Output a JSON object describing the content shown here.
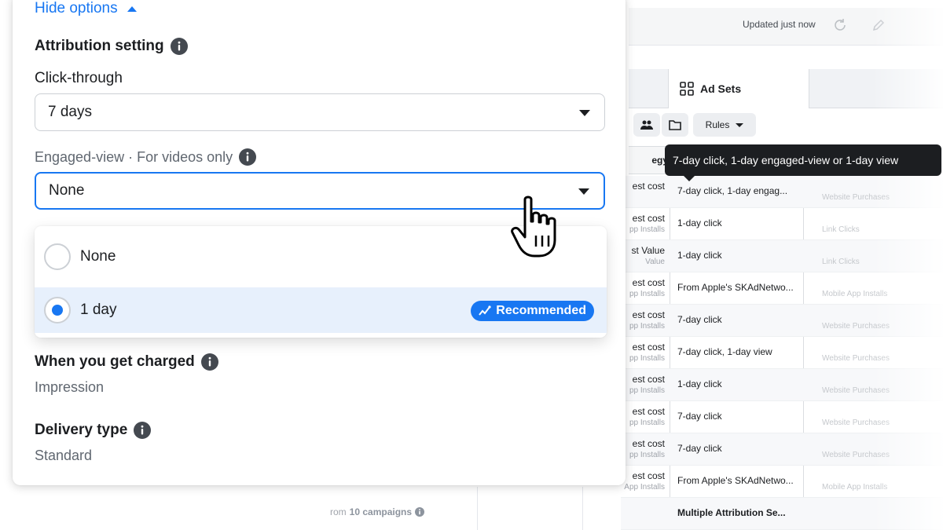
{
  "background": {
    "updated_text": "Updated just now",
    "tab_label": "Ad Sets",
    "rules_label": "Rules",
    "strategy_header": "egy",
    "rows": [
      {
        "s1": "est cost",
        "s2": "",
        "attr": "7-day click, 1-day engag...",
        "result": "Website Purchases"
      },
      {
        "s1": "est cost",
        "s2": "pp Installs",
        "attr": "1-day click",
        "result": "Link Clicks"
      },
      {
        "s1": "st Value",
        "s2": "Value",
        "attr": "1-day click",
        "result": "Link Clicks"
      },
      {
        "s1": "est cost",
        "s2": "pp Installs",
        "attr": "From Apple's SKAdNetwo...",
        "result": "Mobile App Installs"
      },
      {
        "s1": "est cost",
        "s2": "pp Installs",
        "attr": "7-day click",
        "result": "Website Purchases"
      },
      {
        "s1": "est cost",
        "s2": "pp Installs",
        "attr": "7-day click, 1-day view",
        "result": "Website Purchases"
      },
      {
        "s1": "est cost",
        "s2": "pp Installs",
        "attr": "1-day click",
        "result": "Website Purchases"
      },
      {
        "s1": "est cost",
        "s2": "pp Installs",
        "attr": "7-day click",
        "result": "Website Purchases"
      },
      {
        "s1": "est cost",
        "s2": "pp Installs",
        "attr": "7-day click",
        "result": "Website Purchases"
      },
      {
        "s1": "est cost",
        "s2": "App Installs",
        "attr": "From Apple's SKAdNetwo...",
        "result": "Mobile App Installs"
      },
      {
        "s1": "",
        "s2": "",
        "attr": "Multiple Attribution Se...",
        "result": ""
      }
    ],
    "bottom_prefix": "rom",
    "bottom_campaigns": "10 campaigns"
  },
  "tooltip": {
    "text": "7-day click, 1-day engaged-view or 1-day view"
  },
  "panel": {
    "hide_options": "Hide options",
    "attribution_title": "Attribution setting",
    "click_through_label": "Click-through",
    "click_through_value": "7 days",
    "engaged_view_label": "Engaged-view · For videos only",
    "engaged_view_value": "None",
    "options": [
      {
        "label": "None",
        "selected": false
      },
      {
        "label": "1 day",
        "selected": true
      }
    ],
    "recommended_badge": "Recommended",
    "charged_title": "When you get charged",
    "charged_value": "Impression",
    "delivery_title": "Delivery type",
    "delivery_value": "Standard"
  },
  "colors": {
    "accent": "#1877f2",
    "tooltip_bg": "#1c1e21",
    "selected_row_bg": "#e7f0fc"
  },
  "icons": [
    "chevron-up-icon",
    "info-icon",
    "chevron-down-icon",
    "sparkline-icon",
    "hand-cursor-icon",
    "refresh-icon",
    "pencil-icon",
    "grid-icon",
    "people-icon",
    "folder-icon"
  ]
}
